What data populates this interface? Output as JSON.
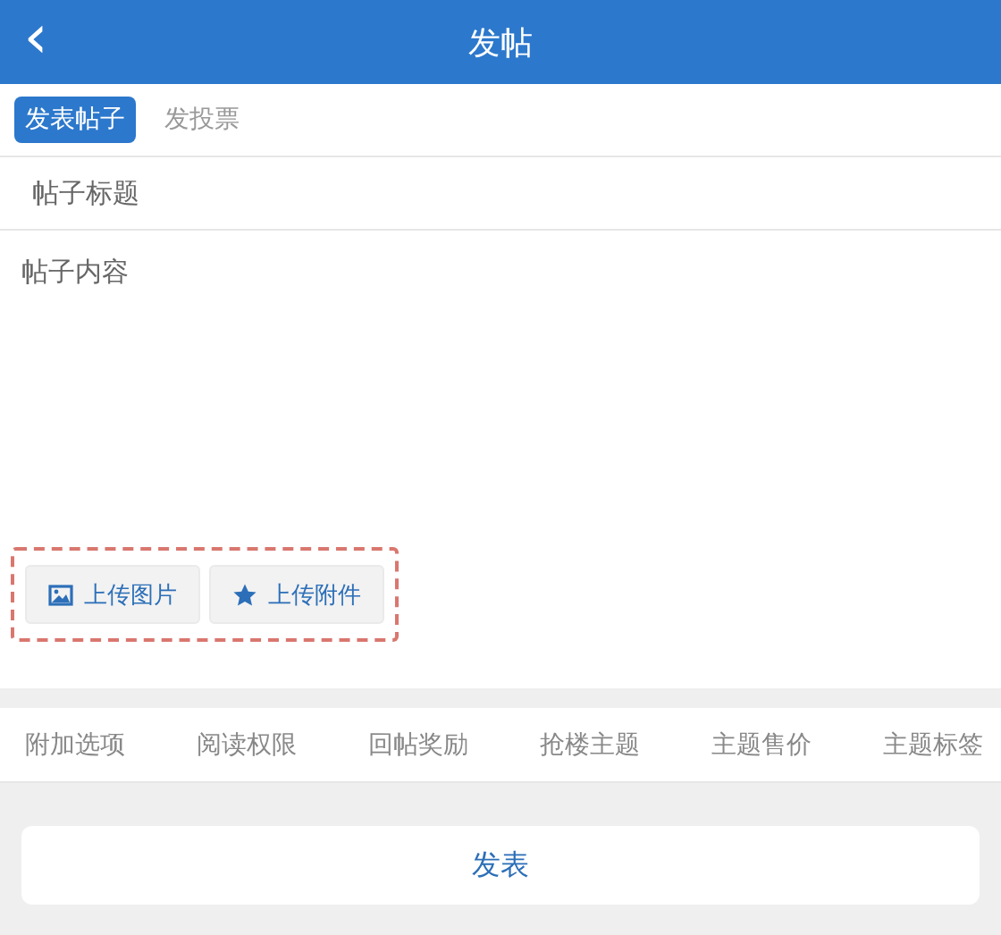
{
  "header": {
    "back_icon": "‹",
    "title": "发帖"
  },
  "tabs": [
    {
      "label": "发表帖子",
      "selected": true
    },
    {
      "label": "发投票",
      "selected": false
    }
  ],
  "title_field": {
    "placeholder": "帖子标题"
  },
  "content_field": {
    "placeholder": "帖子内容"
  },
  "upload_buttons": [
    {
      "kind": "image",
      "label": "上传图片"
    },
    {
      "kind": "star",
      "label": "上传附件"
    }
  ],
  "options": [
    "附加选项",
    "阅读权限",
    "回帖奖励",
    "抢楼主题",
    "主题售价",
    "主题标签"
  ],
  "submit_button": "发表"
}
